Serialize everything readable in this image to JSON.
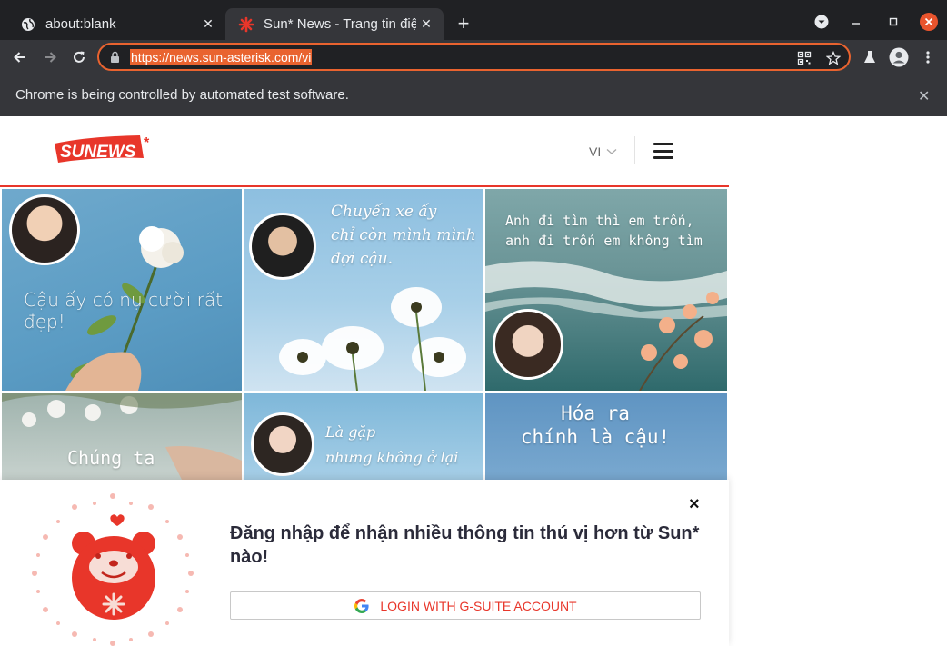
{
  "browser": {
    "tabs": [
      {
        "title": "about:blank",
        "favicon": "globe-icon",
        "active": false
      },
      {
        "title": "Sun* News - Trang tin điệ",
        "favicon": "sun-asterisk-icon",
        "active": true
      }
    ],
    "url": "https://news.sun-asterisk.com/vi",
    "infobar_message": "Chrome is being controlled by automated test software.",
    "accent_color": "#e9632f"
  },
  "site": {
    "logo_text": "SUNEWS",
    "logo_mark": "*",
    "language": "VI",
    "brand_color": "#e8362a"
  },
  "grid": {
    "tiles": [
      {
        "caption": "Cậu ấy có nụ cười rất đẹp!"
      },
      {
        "caption": "Chuyến xe ấy\nchỉ còn mình mình\nđợi cậu."
      },
      {
        "caption": "Anh đi tìm thì em trốn,\nanh đi trốn em không tìm"
      },
      {
        "caption": "Chúng ta"
      },
      {
        "caption": "Là gặp\nnhưng không ở lại"
      },
      {
        "caption": "Hóa ra\nchính là cậu!"
      }
    ]
  },
  "popup": {
    "title": "Đăng nhập để nhận nhiều thông tin thú vị hơn từ Sun* nào!",
    "login_button": "LOGIN WITH G-SUITE ACCOUNT",
    "close_label": "×"
  }
}
